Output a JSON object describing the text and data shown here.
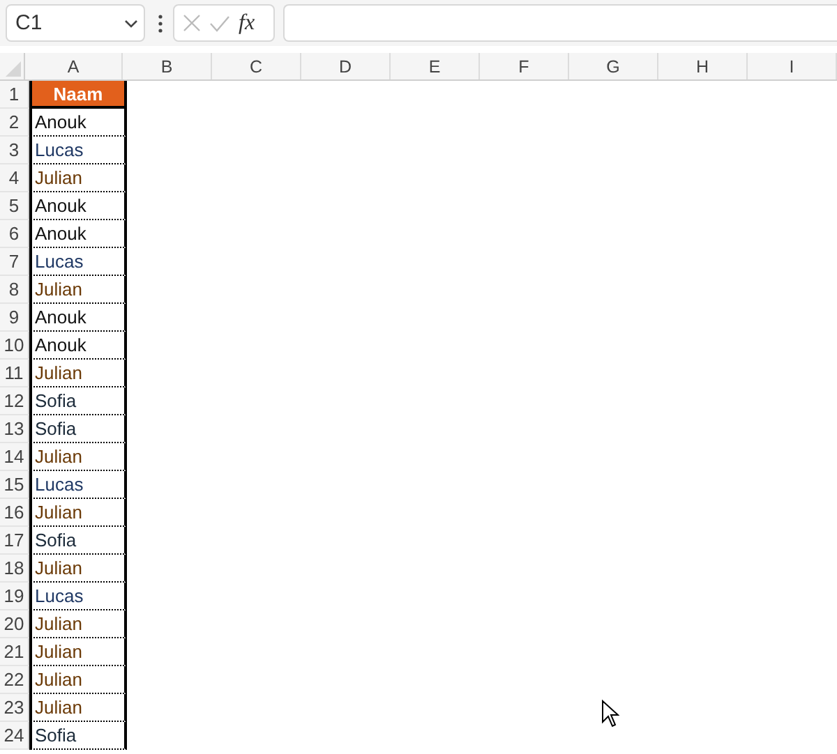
{
  "name_box": {
    "value": "C1"
  },
  "formula_bar": {
    "function_label": "fx"
  },
  "columns": [
    "A",
    "B",
    "C",
    "D",
    "E",
    "F",
    "G",
    "H",
    "I"
  ],
  "header_row": {
    "row": "1",
    "text": "Naam"
  },
  "rows": [
    {
      "row": "2",
      "name": "Anouk",
      "color": "#111111"
    },
    {
      "row": "3",
      "name": "Lucas",
      "color": "#1f3864"
    },
    {
      "row": "4",
      "name": "Julian",
      "color": "#6b3a07"
    },
    {
      "row": "5",
      "name": "Anouk",
      "color": "#111111"
    },
    {
      "row": "6",
      "name": "Anouk",
      "color": "#111111"
    },
    {
      "row": "7",
      "name": "Lucas",
      "color": "#1f3864"
    },
    {
      "row": "8",
      "name": "Julian",
      "color": "#6b3a07"
    },
    {
      "row": "9",
      "name": "Anouk",
      "color": "#111111"
    },
    {
      "row": "10",
      "name": "Anouk",
      "color": "#111111"
    },
    {
      "row": "11",
      "name": "Julian",
      "color": "#6b3a07"
    },
    {
      "row": "12",
      "name": "Sofia",
      "color": "#1c2b3a"
    },
    {
      "row": "13",
      "name": "Sofia",
      "color": "#1c2b3a"
    },
    {
      "row": "14",
      "name": "Julian",
      "color": "#6b3a07"
    },
    {
      "row": "15",
      "name": "Lucas",
      "color": "#1f3864"
    },
    {
      "row": "16",
      "name": "Julian",
      "color": "#6b3a07"
    },
    {
      "row": "17",
      "name": "Sofia",
      "color": "#1c2b3a"
    },
    {
      "row": "18",
      "name": "Julian",
      "color": "#6b3a07"
    },
    {
      "row": "19",
      "name": "Lucas",
      "color": "#1f3864"
    },
    {
      "row": "20",
      "name": "Julian",
      "color": "#6b3a07"
    },
    {
      "row": "21",
      "name": "Julian",
      "color": "#6b3a07"
    },
    {
      "row": "22",
      "name": "Julian",
      "color": "#6b3a07"
    },
    {
      "row": "23",
      "name": "Julian",
      "color": "#6b3a07"
    },
    {
      "row": "24",
      "name": "Sofia",
      "color": "#1c2b3a"
    }
  ]
}
